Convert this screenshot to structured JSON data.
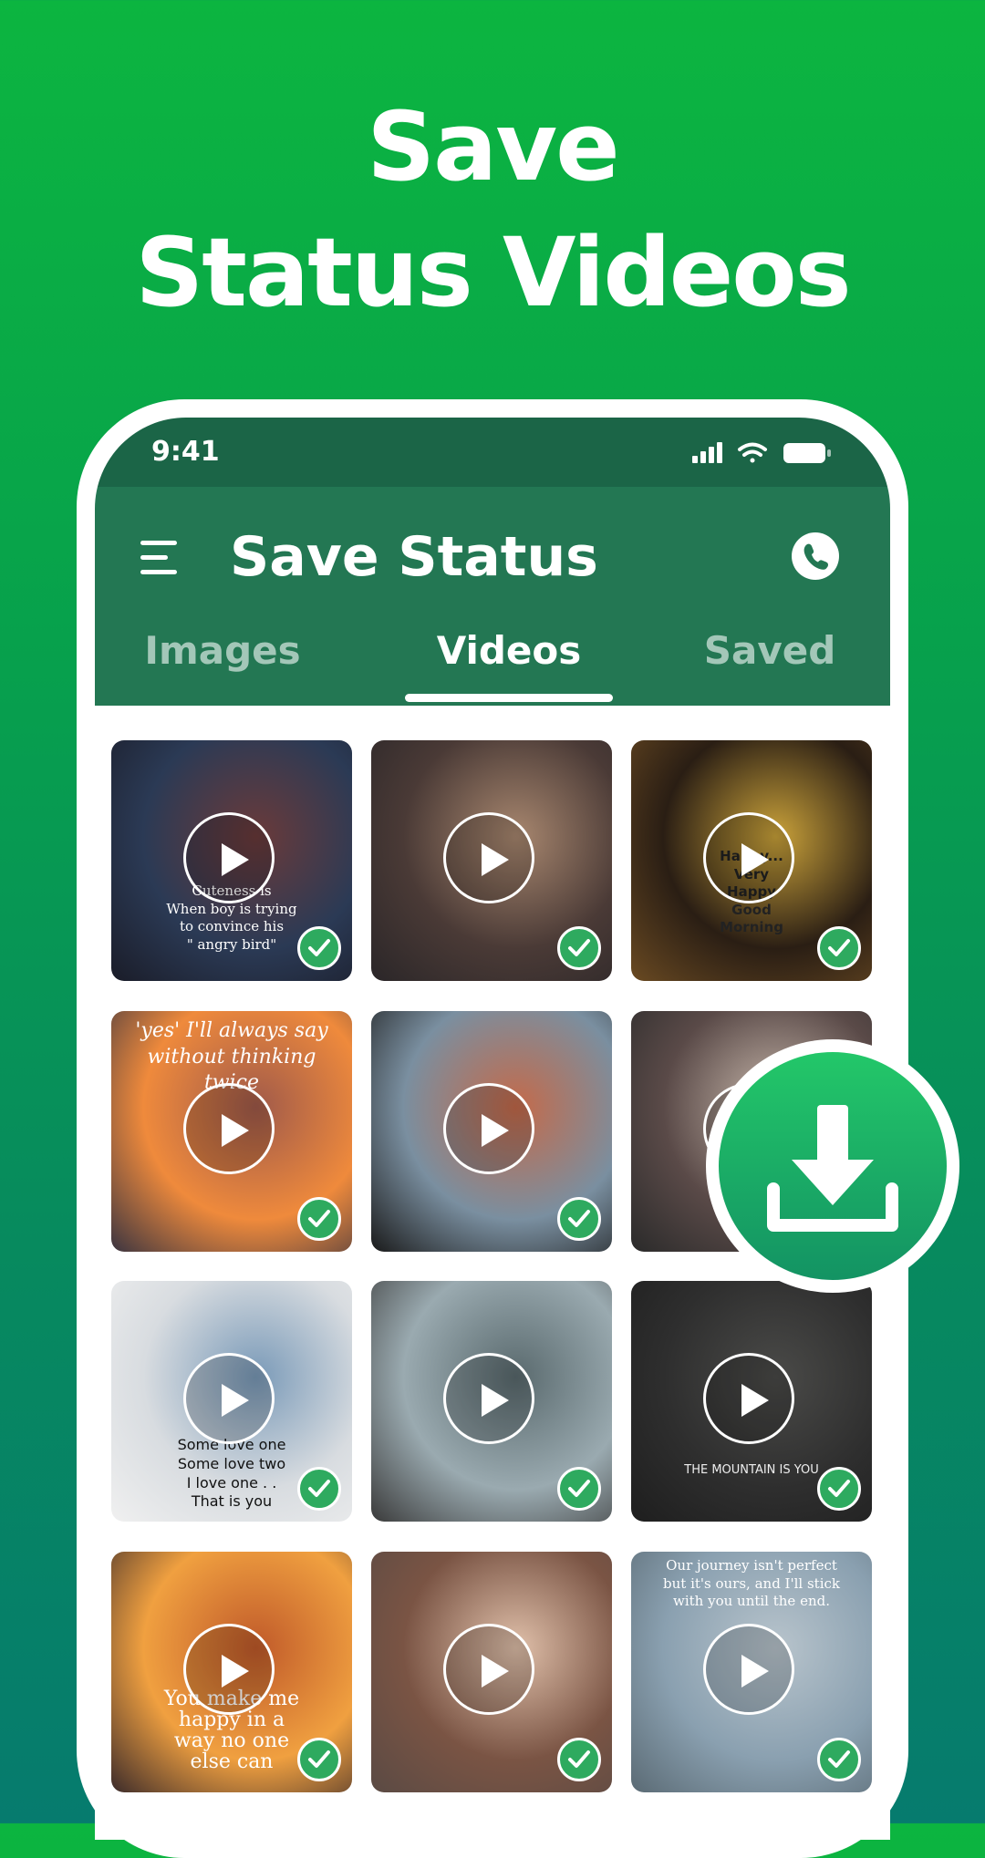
{
  "headline": {
    "line1": "Save",
    "line2": "Status Videos"
  },
  "status_bar": {
    "time": "9:41"
  },
  "app_bar": {
    "title": "Save Status"
  },
  "tabs": [
    {
      "label": "Images",
      "active": false
    },
    {
      "label": "Videos",
      "active": true
    },
    {
      "label": "Saved",
      "active": false
    }
  ],
  "tiles": [
    {
      "caption": "Cuteness is\nWhen boy is trying\nto convince his\n\" angry bird\"",
      "colors": [
        "#2b3a55",
        "#6a3a3a",
        "#1a1c28"
      ]
    },
    {
      "caption": "",
      "colors": [
        "#4a3a36",
        "#a8876f",
        "#2a2628"
      ]
    },
    {
      "caption": "Happy...\nVery\nHappy\nGood\nMorning",
      "colors": [
        "#2a1e14",
        "#caa23a",
        "#6a4a22"
      ]
    },
    {
      "caption": "'yes' I'll always say\nwithout thinking\ntwice",
      "colors": [
        "#ef8a3c",
        "#a05a4a",
        "#3a3440"
      ]
    },
    {
      "caption": "",
      "colors": [
        "#7a8fa0",
        "#c46a4a",
        "#1a1a1a"
      ]
    },
    {
      "caption": "",
      "colors": [
        "#5a4a48",
        "#c8b8ac",
        "#2a2a2a"
      ]
    },
    {
      "caption": "Some love one\nSome love two\nI love one . .\nThat is you",
      "colors": [
        "#d8dce0",
        "#7a9ab8",
        "#f0f0f0"
      ]
    },
    {
      "caption": "",
      "colors": [
        "#9aaab0",
        "#5a6a6e",
        "#3a3a3a"
      ]
    },
    {
      "caption": "THE MOUNTAIN IS YOU",
      "colors": [
        "#2e2e2e",
        "#4a4a48",
        "#1e1e1e"
      ]
    },
    {
      "caption": "You make me\nhappy in a\nway no one\nelse can",
      "colors": [
        "#f0a040",
        "#c05a2a",
        "#3a2a2a"
      ]
    },
    {
      "caption": "",
      "colors": [
        "#7a5444",
        "#e0c0aa",
        "#5a4a44"
      ]
    },
    {
      "caption": "Our journey isn't perfect\nbut it's ours, and I'll stick\nwith you until the end.",
      "colors": [
        "#8aa0b0",
        "#b8c4cc",
        "#5a6a74"
      ]
    }
  ],
  "theme": {
    "status_bar_color": "#1b6547",
    "app_bar_color": "#237753",
    "check_color": "#2eaa5f",
    "fab_color": "#1aa865"
  },
  "icons": {
    "menu": "menu-icon",
    "call": "phone-call-icon",
    "play": "play-icon",
    "check": "check-icon",
    "download": "download-icon",
    "signal": "signal-icon",
    "wifi": "wifi-icon",
    "battery": "battery-icon"
  }
}
